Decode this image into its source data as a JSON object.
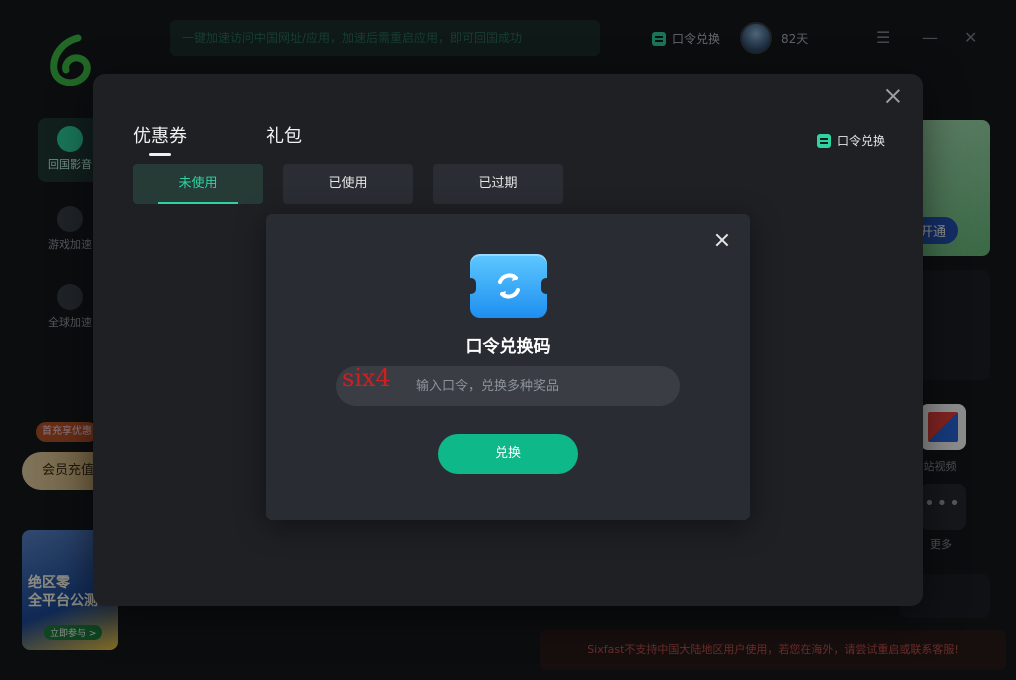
{
  "background": {
    "notice": "一键加速访问中国网址/应用，加速后需重启应用，即可回国成功",
    "top_redeem_label": "口令兑换",
    "days_label": "82天",
    "sidebar": {
      "items": [
        {
          "label": "回国影音",
          "icon": "play-icon"
        },
        {
          "label": "游戏加速",
          "icon": "gamepad-icon"
        },
        {
          "label": "全球加速",
          "icon": "globe-icon"
        }
      ],
      "vip_tag": "首充享优惠",
      "vip_button": "会员充值",
      "promo": {
        "title": "绝区零\n全平台公测",
        "cta": "立即参与 >"
      }
    },
    "right_panel": {
      "open_button": "开通"
    },
    "sites": [
      {
        "label": "B站视频",
        "icon": "bilibili-icon"
      },
      {
        "label": "更多",
        "icon": "more-icon"
      }
    ],
    "warning": "Sixfast不支持中国大陆地区用户使用，若您在海外，请尝试重启或联系客服!"
  },
  "modal": {
    "tabs": [
      {
        "label": "优惠券",
        "active": true
      },
      {
        "label": "礼包",
        "active": false
      }
    ],
    "redeem_label": "口令兑换",
    "sub_tabs": [
      {
        "label": "未使用",
        "active": true
      },
      {
        "label": "已使用",
        "active": false
      },
      {
        "label": "已过期",
        "active": false
      }
    ]
  },
  "dialog": {
    "title": "口令兑换码",
    "input_placeholder": "输入口令，兑换多种奖品",
    "input_value": "six4",
    "button_label": "兑换",
    "icon": "ticket-icon"
  },
  "colors": {
    "accent": "#0fb889",
    "accent_text": "#2fd3a0",
    "modal_bg": "#1e2024",
    "dialog_bg": "#2a2c33",
    "warning": "#c2524e"
  }
}
